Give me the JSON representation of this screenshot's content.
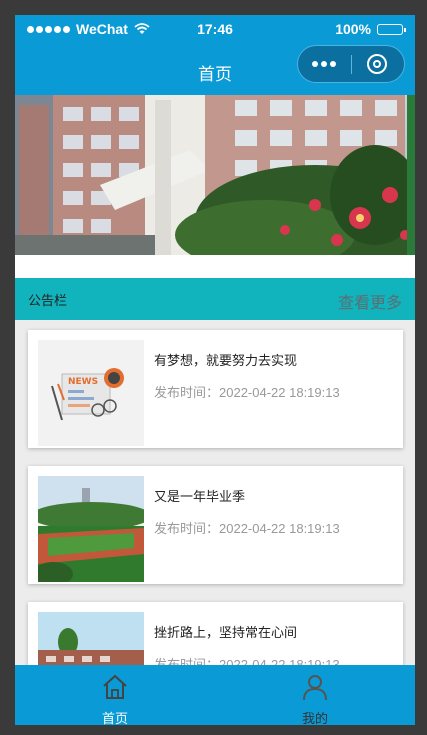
{
  "status_bar": {
    "carrier": "WeChat",
    "time": "17:46",
    "battery": "100%"
  },
  "navbar": {
    "title": "首页"
  },
  "notice": {
    "label": "公告栏",
    "more": "查看更多"
  },
  "news": [
    {
      "title": "有梦想，就要努力去实现",
      "date": "发布时间：2022-04-22 18:19:13"
    },
    {
      "title": "又是一年毕业季",
      "date": "发布时间：2022-04-22 18:19:13"
    },
    {
      "title": "挫折路上，坚持常在心间",
      "date": "发布时间：2022-04-22 18:19:13"
    }
  ],
  "tabbar": {
    "home": "首页",
    "mine": "我的"
  },
  "colors": {
    "primary": "#0a9ad6",
    "notice_bar": "#11b3bc",
    "active_tab": "#ffffff",
    "inactive_tab": "#333333"
  }
}
